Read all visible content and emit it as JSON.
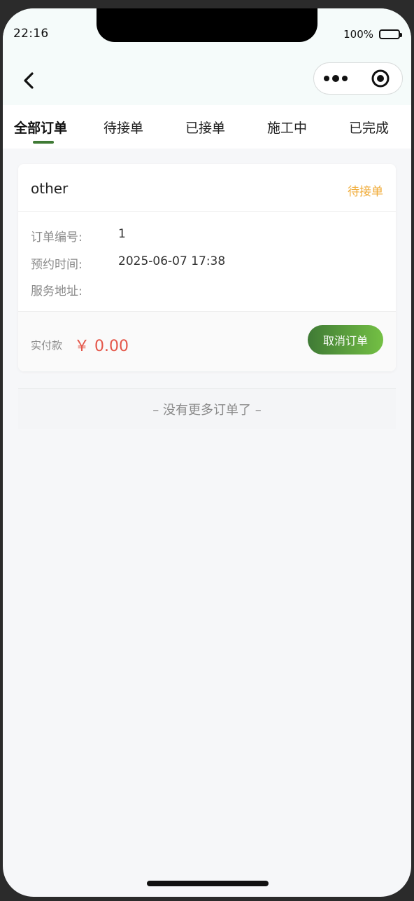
{
  "status_bar": {
    "time": "22:16",
    "battery_percent": "100%"
  },
  "nav": {
    "back_icon": "chevron-left-icon",
    "more_icon": "more-dots-icon",
    "close_icon": "target-circle-icon"
  },
  "tabs": [
    {
      "label": "全部订单",
      "active": true
    },
    {
      "label": "待接单",
      "active": false
    },
    {
      "label": "已接单",
      "active": false
    },
    {
      "label": "施工中",
      "active": false
    },
    {
      "label": "已完成",
      "active": false
    }
  ],
  "order": {
    "title": "other",
    "status": "待接单",
    "rows": [
      {
        "label": "订单编号:",
        "value": "1"
      },
      {
        "label": "预约时间:",
        "value": "2025-06-07 17:38"
      },
      {
        "label": "服务地址:",
        "value": ""
      }
    ],
    "pay_label": "实付款",
    "pay_amount": "￥ 0.00",
    "cancel_label": "取消订单"
  },
  "footer_text": "– 没有更多订单了 –",
  "colors": {
    "accent_green": "#3f7a35",
    "status_orange": "#f0ad3c",
    "price_red": "#e45548"
  }
}
